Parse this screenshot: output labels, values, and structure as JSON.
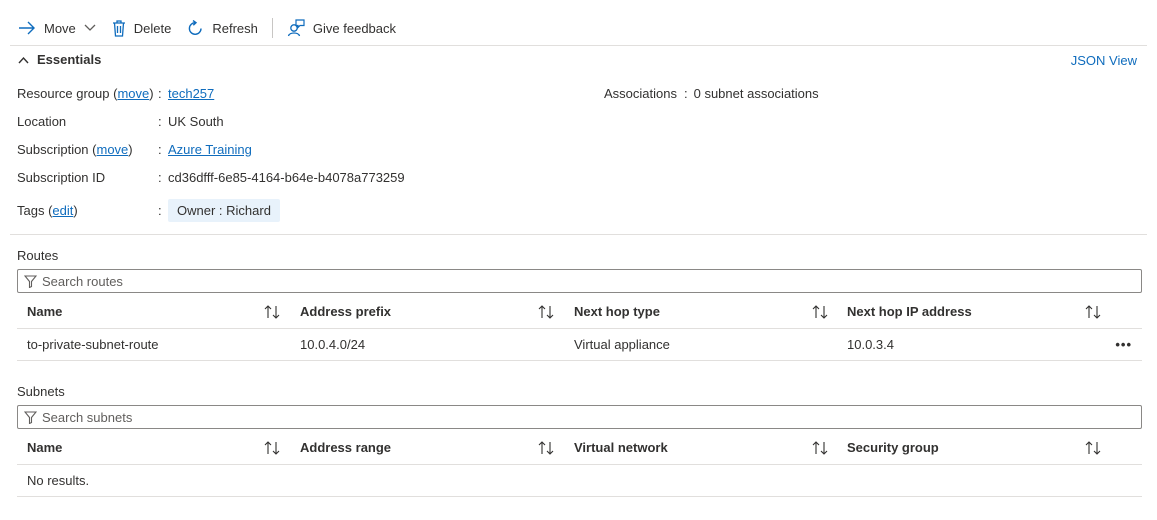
{
  "toolbar": {
    "move": "Move",
    "delete": "Delete",
    "refresh": "Refresh",
    "feedback": "Give feedback"
  },
  "essentials": {
    "title": "Essentials",
    "json_view": "JSON View",
    "resource_group": {
      "label": "Resource group",
      "action": "move",
      "value": "tech257"
    },
    "location": {
      "label": "Location",
      "value": "UK South"
    },
    "subscription": {
      "label": "Subscription",
      "action": "move",
      "value": "Azure Training"
    },
    "subscription_id": {
      "label": "Subscription ID",
      "value": "cd36dfff-6e85-4164-b64e-b4078a773259"
    },
    "tags": {
      "label": "Tags",
      "action": "edit",
      "value": "Owner : Richard"
    },
    "associations": {
      "label": "Associations",
      "value": "0 subnet associations"
    }
  },
  "routes": {
    "title": "Routes",
    "search_placeholder": "Search routes",
    "columns": [
      "Name",
      "Address prefix",
      "Next hop type",
      "Next hop IP address"
    ],
    "rows": [
      {
        "name": "to-private-subnet-route",
        "prefix": "10.0.4.0/24",
        "hop_type": "Virtual appliance",
        "hop_ip": "10.0.3.4"
      }
    ],
    "more": "•••"
  },
  "subnets": {
    "title": "Subnets",
    "search_placeholder": "Search subnets",
    "columns": [
      "Name",
      "Address range",
      "Virtual network",
      "Security group"
    ],
    "empty": "No results."
  },
  "icons": {
    "sort": "sort-arrows-icon",
    "filter": "filter-icon"
  },
  "colors": {
    "link": "#0f6cbd",
    "tag_bg": "#e8f2fb"
  }
}
